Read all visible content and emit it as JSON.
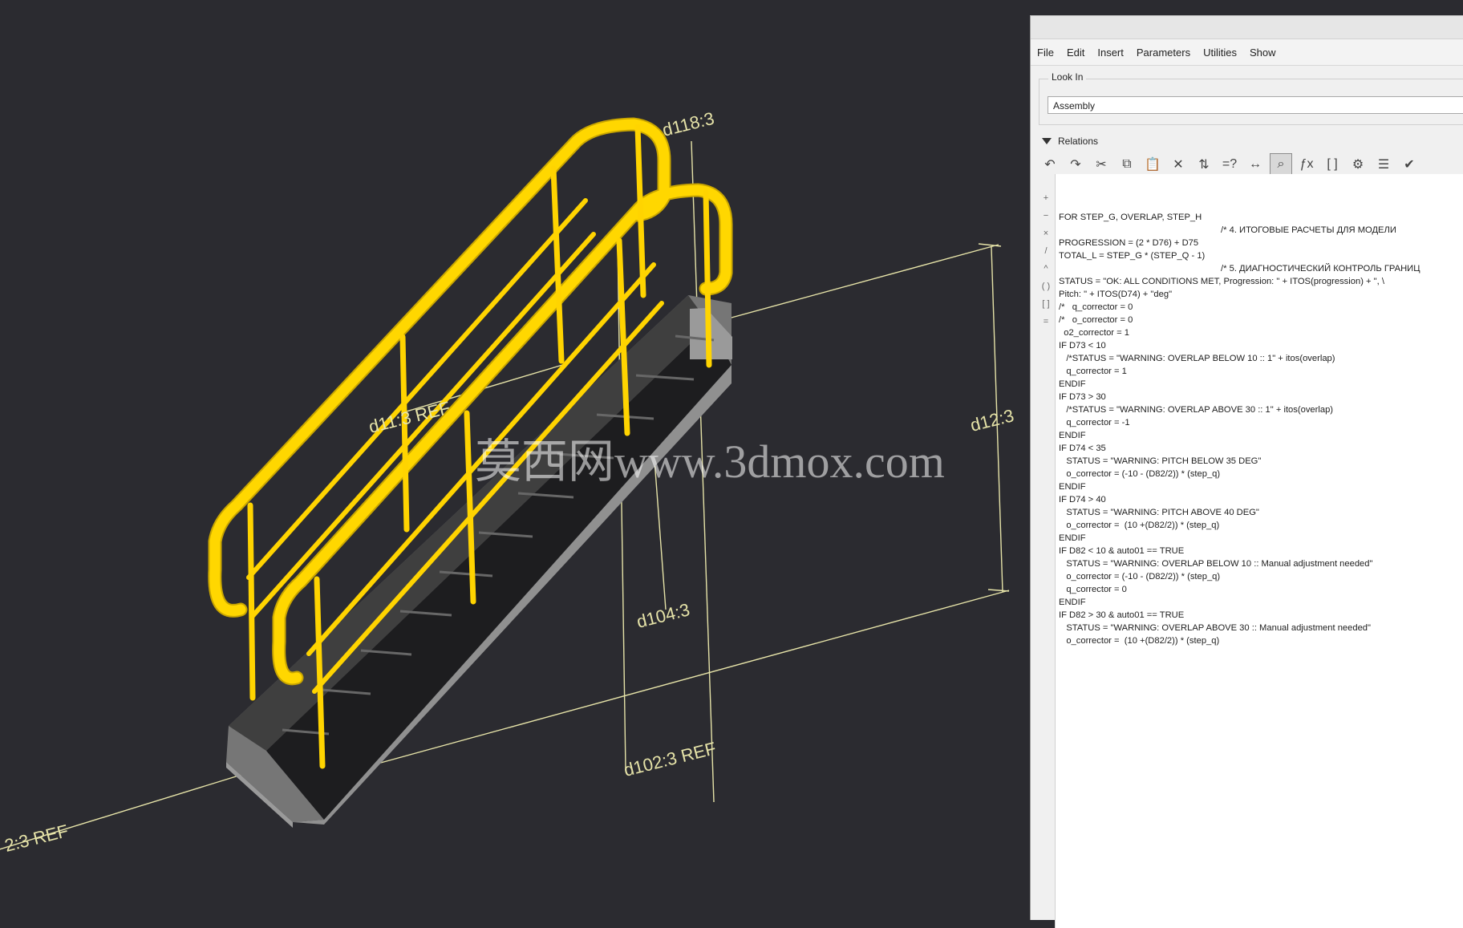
{
  "viewport": {
    "dimensions": [
      "d118:3",
      "d12:3",
      "d104:3",
      "d102:3 REF",
      "d11:3 REF",
      "2:3 REF"
    ],
    "watermark": "莫西网www.3dmox.com"
  },
  "menu": [
    "File",
    "Edit",
    "Insert",
    "Parameters",
    "Utilities",
    "Show"
  ],
  "look_in": {
    "label": "Look In",
    "value": "Assembly"
  },
  "relations": {
    "label": "Relations",
    "side_ops": [
      "+",
      "−",
      "×",
      "/",
      "^",
      "( )",
      "[ ]",
      "="
    ],
    "code_lines": [
      "FOR STEP_G, OVERLAP, STEP_H",
      "",
      "",
      "",
      "                                                                 /* 4. ИТОГОВЫЕ РАСЧЕТЫ ДЛЯ МОДЕЛИ",
      "",
      "PROGRESSION = (2 * D76) + D75",
      "TOTAL_L = STEP_G * (STEP_Q - 1)",
      "",
      "",
      "                                                                 /* 5. ДИАГНОСТИЧЕСКИЙ КОНТРОЛЬ ГРАНИЦ",
      "",
      "STATUS = \"OK: ALL CONDITIONS MET, Progression: \" + ITOS(progression) + \", \\",
      "Pitch: \" + ITOS(D74) + \"deg\"",
      "",
      "/*   q_corrector = 0",
      "/*   o_corrector = 0",
      "  o2_corrector = 1",
      "",
      "",
      "",
      "",
      "IF D73 < 10",
      "   /*STATUS = \"WARNING: OVERLAP BELOW 10 :: 1\" + itos(overlap)",
      "   q_corrector = 1",
      "",
      "ENDIF",
      "",
      "IF D73 > 30",
      "   /*STATUS = \"WARNING: OVERLAP ABOVE 30 :: 1\" + itos(overlap)",
      "   q_corrector = -1",
      "",
      "ENDIF",
      "",
      "IF D74 < 35",
      "   STATUS = \"WARNING: PITCH BELOW 35 DEG\"",
      "   o_corrector = (-10 - (D82/2)) * (step_q)",
      "ENDIF",
      "",
      "IF D74 > 40",
      "   STATUS = \"WARNING: PITCH ABOVE 40 DEG\"",
      "   o_corrector =  (10 +(D82/2)) * (step_q)",
      "ENDIF",
      "",
      "",
      "IF D82 < 10 & auto01 == TRUE",
      "   STATUS = \"WARNING: OVERLAP BELOW 10 :: Manual adjustment needed\"",
      "",
      "   o_corrector = (-10 - (D82/2)) * (step_q)",
      "   q_corrector = 0",
      "",
      "ENDIF",
      "",
      "IF D82 > 30 & auto01 == TRUE",
      "   STATUS = \"WARNING: OVERLAP ABOVE 30 :: Manual adjustment needed\"",
      "",
      "   o_corrector =  (10 +(D82/2)) * (step_q)"
    ]
  },
  "toolbar": [
    "undo-icon",
    "redo-icon",
    "cut-icon",
    "copy-icon",
    "paste-icon",
    "delete-icon",
    "evaluate-icon",
    "verify-icon",
    "dimension-icon",
    "show-dimensions-icon",
    "function-icon",
    "brackets-icon",
    "parameters-icon",
    "sort-icon",
    "check-icon"
  ]
}
